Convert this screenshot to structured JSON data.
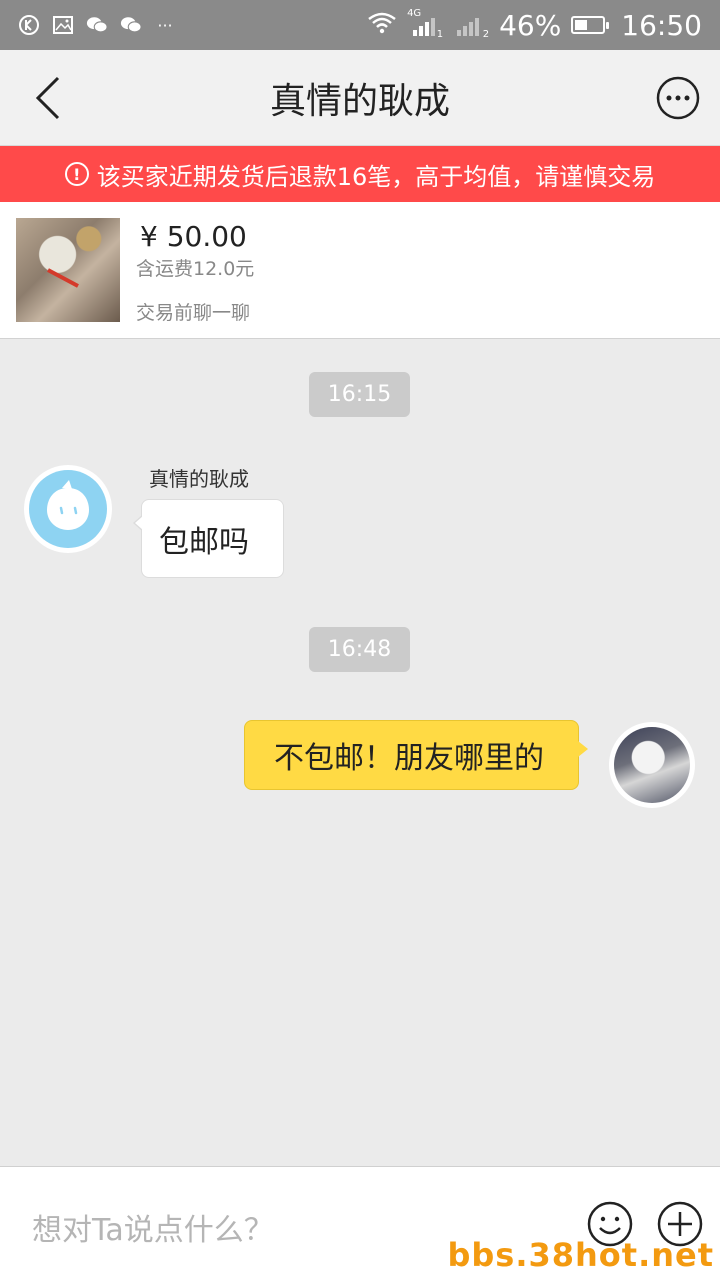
{
  "status_bar": {
    "icons_left": [
      "k-app-icon",
      "image-icon",
      "wechat-icon",
      "wechat-icon",
      "more-dots-icon"
    ],
    "more_symbol": "···",
    "network": "4G",
    "sim1": "1",
    "sim2": "2",
    "battery_percent": "46%",
    "battery_level": 0.46,
    "time": "16:50"
  },
  "header": {
    "title": "真情的耿成",
    "back_icon": "chevron-left-icon",
    "more_icon": "more-circle-icon"
  },
  "warning": {
    "icon_symbol": "!",
    "text": "该买家近期发货后退款16笔，高于均值，请谨慎交易",
    "color": "#ff4a4a"
  },
  "product": {
    "price": "¥ 50.00",
    "shipping": "含运费12.0元",
    "cta": "交易前聊一聊"
  },
  "messages": [
    {
      "time": "16:15",
      "sender": "真情的耿成",
      "text": "包邮吗",
      "side": "left"
    },
    {
      "time": "16:48",
      "text": "不包邮！朋友哪里的",
      "side": "right"
    }
  ],
  "input": {
    "placeholder": "想对Ta说点什么？",
    "emoji_icon": "smiley-icon",
    "plus_icon": "plus-circle-icon"
  },
  "watermark": "bbs.38hot.net",
  "colors": {
    "status_bar": "#8a8a8a",
    "accent_bubble": "#ffda44",
    "chat_bg": "#ebebeb"
  }
}
